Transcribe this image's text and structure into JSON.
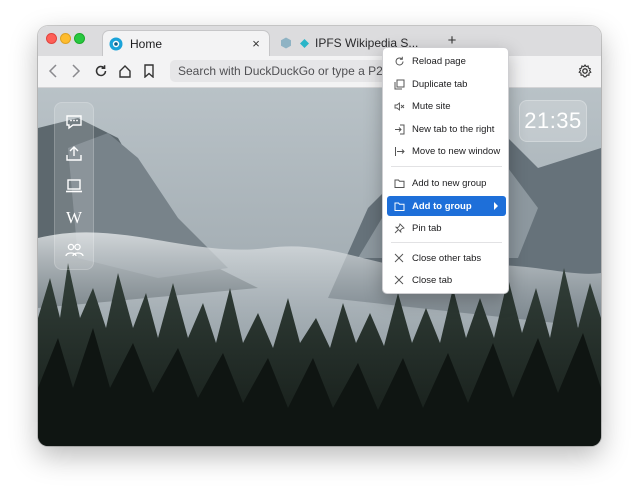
{
  "window": {
    "tabs": [
      {
        "title": "Home",
        "close_icon": "×"
      },
      {
        "title": "IPFS Wikipedia S..."
      }
    ],
    "new_tab": "+"
  },
  "toolbar": {
    "address_placeholder": "Search with DuckDuckGo or type a P2P URL"
  },
  "sidebar": {
    "items": [
      "chat-icon",
      "share-icon",
      "laptop-icon",
      "wikipedia-icon",
      "people-icon"
    ],
    "wiki_glyph": "W"
  },
  "clock": {
    "time": "21:35"
  },
  "context_menu": {
    "items": [
      {
        "label": "Reload page",
        "icon": "reload-icon"
      },
      {
        "label": "Duplicate tab",
        "icon": "duplicate-icon"
      },
      {
        "label": "Mute site",
        "icon": "mute-icon"
      },
      {
        "label": "New tab to the right",
        "icon": "new-tab-right-icon"
      },
      {
        "label": "Move to new window",
        "icon": "move-window-icon"
      },
      {
        "label": "Add to new group",
        "icon": "folder-icon"
      },
      {
        "label": "Add to group",
        "icon": "folder-icon",
        "highlighted": true
      },
      {
        "label": "Pin tab",
        "icon": "pin-icon"
      },
      {
        "label": "Close other tabs",
        "icon": "close-icon"
      },
      {
        "label": "Close tab",
        "icon": "close-icon"
      }
    ]
  },
  "colors": {
    "highlight": "#1e6fd9",
    "sky": "#a9b3b9",
    "forest": "#1f2a24"
  }
}
